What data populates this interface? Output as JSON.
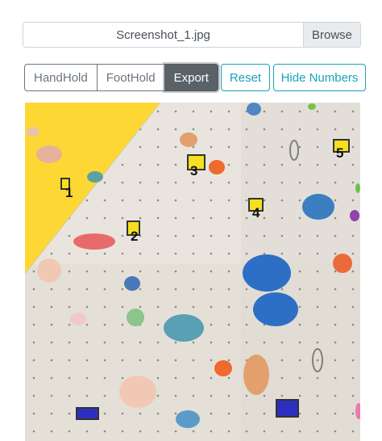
{
  "file": {
    "name": "Screenshot_1.jpg",
    "browse": "Browse"
  },
  "modes": [
    {
      "label": "HandHold",
      "active": false
    },
    {
      "label": "FootHold",
      "active": false
    },
    {
      "label": "Export",
      "active": true
    }
  ],
  "actions": {
    "reset": "Reset",
    "hide_numbers": "Hide Numbers"
  },
  "holds": [
    {
      "label": "1",
      "type": "hand"
    },
    {
      "label": "2",
      "type": "hand"
    },
    {
      "label": "3",
      "type": "hand"
    },
    {
      "label": "4",
      "type": "hand"
    },
    {
      "label": "5",
      "type": "hand"
    },
    {
      "label": "",
      "type": "foot"
    },
    {
      "label": "",
      "type": "foot"
    }
  ],
  "colors": {
    "hand_marker": "#f6df1f",
    "foot_marker": "#2d2fc0",
    "accent": "#17a2b8",
    "active_button": "#5a6268"
  }
}
